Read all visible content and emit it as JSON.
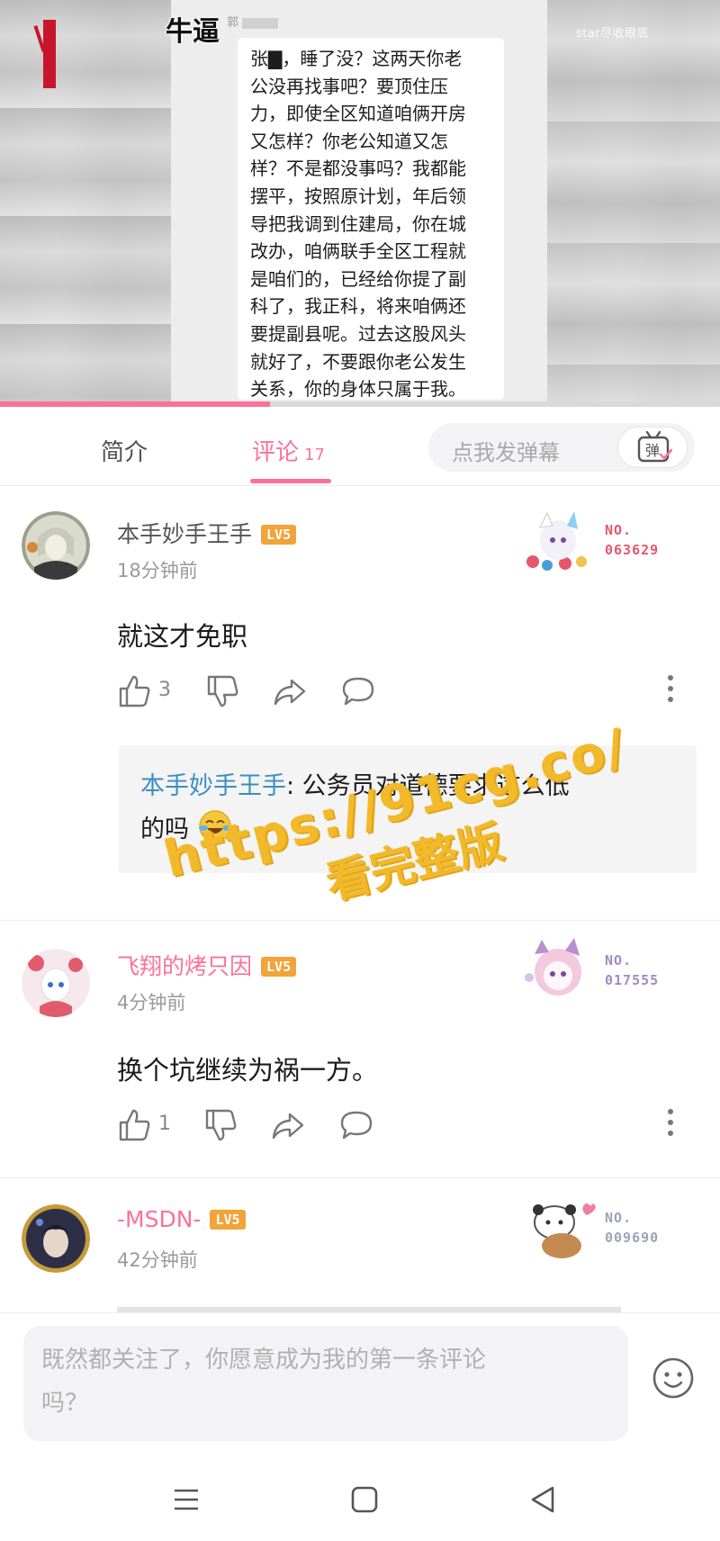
{
  "video": {
    "caption": "牛逼",
    "channel_tag": "star尽收眼底",
    "chat_message_lines": [
      "张▇，睡了没？这两天你老",
      "公没再找事吧？要顶住压",
      "力，即使全区知道咱俩开房",
      "又怎样？你老公知道又怎",
      "样？不是都没事吗？我都能",
      "摆平，按照原计划，年后领",
      "导把我调到住建局，你在城",
      "改办，咱俩联手全区工程就",
      "是咱们的，已经给你提了副",
      "科了，我正科，将来咱俩还",
      "要提副县呢。过去这股风头",
      "就好了，不要跟你老公发生",
      "关系，你的身体只属于我。"
    ],
    "progress_fraction": 0.375
  },
  "tabs": {
    "intro_label": "简介",
    "comments_label": "评论",
    "comments_count": "17",
    "danmaku_placeholder": "点我发弹幕",
    "danmaku_button_icon": "danmaku-toggle-icon",
    "danmaku_button_glyph": "弹"
  },
  "comments": [
    {
      "username": "本手妙手王手",
      "level": "LV5",
      "time": "18分钟前",
      "text": "就这才免职",
      "likes": "3",
      "fan_number_label": "NO.",
      "fan_number": "063629",
      "fan_color": "#e5576d",
      "reply": {
        "author": "本手妙手王手",
        "text_line1": ": 公务员对道德要求这么低",
        "text_line2": "的吗"
      }
    },
    {
      "username": "飞翔的烤只因",
      "level": "LV5",
      "time": "4分钟前",
      "text": "换个坑继续为祸一方。",
      "likes": "1",
      "fan_number_label": "NO.",
      "fan_number": "017555",
      "fan_color": "#a08bc7"
    },
    {
      "username": "-MSDN-",
      "level": "LV5",
      "time": "42分钟前",
      "text": "",
      "likes": "",
      "fan_number_label": "NO.",
      "fan_number": "009690",
      "fan_color": "#9aa5b5"
    }
  ],
  "watermark": {
    "line1": "https://91cg.co/",
    "line2": "看完整版"
  },
  "input": {
    "placeholder_line1": "既然都关注了，你愿意成为我的第一条评论",
    "placeholder_line2": "吗？"
  },
  "colors": {
    "accent": "#fb7299",
    "level_badge": "#f2a33a",
    "reply_name": "#3a8fbf",
    "watermark": "#f2b92a"
  }
}
